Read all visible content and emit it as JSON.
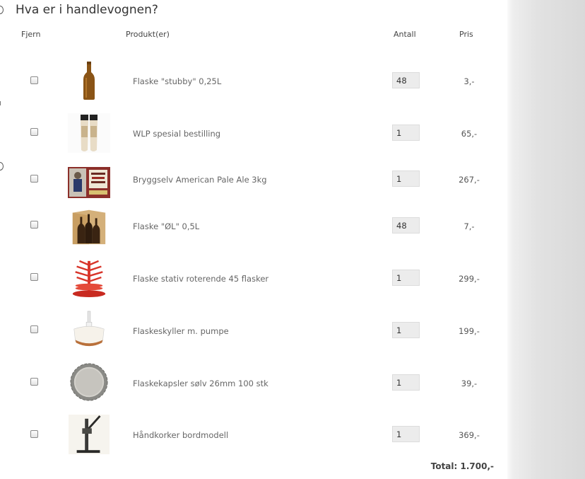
{
  "cart": {
    "title": "Hva er i handlevognen?",
    "headers": {
      "remove": "Fjern",
      "product": "Produkt(er)",
      "quantity": "Antall",
      "price": "Pris"
    },
    "items": [
      {
        "name": "Flaske \"stubby\" 0,25L",
        "quantity": "48",
        "price": "3,-",
        "icon": "beer-bottle-stubby-icon"
      },
      {
        "name": "WLP spesial bestilling",
        "quantity": "1",
        "price": "65,-",
        "icon": "yeast-vials-icon"
      },
      {
        "name": "Bryggselv American Pale Ale 3kg",
        "quantity": "1",
        "price": "267,-",
        "icon": "pale-ale-kit-icon"
      },
      {
        "name": "Flaske \"ØL\" 0,5L",
        "quantity": "48",
        "price": "7,-",
        "icon": "bottle-box-icon"
      },
      {
        "name": "Flaske stativ roterende 45 flasker",
        "quantity": "1",
        "price": "299,-",
        "icon": "bottle-tree-icon"
      },
      {
        "name": "Flaskeskyller m. pumpe",
        "quantity": "1",
        "price": "199,-",
        "icon": "bottle-rinser-icon"
      },
      {
        "name": "Flaskekapsler sølv 26mm 100 stk",
        "quantity": "1",
        "price": "39,-",
        "icon": "bottle-cap-icon"
      },
      {
        "name": "Håndkorker bordmodell",
        "quantity": "1",
        "price": "369,-",
        "icon": "bench-capper-icon"
      }
    ],
    "total": "Total: 1.700,-"
  },
  "colors": {
    "sidebar_gray": "#d9d9d9",
    "input_bg": "#ececec",
    "bottle_brown": "#7a4a12",
    "rack_red": "#d8352a"
  }
}
